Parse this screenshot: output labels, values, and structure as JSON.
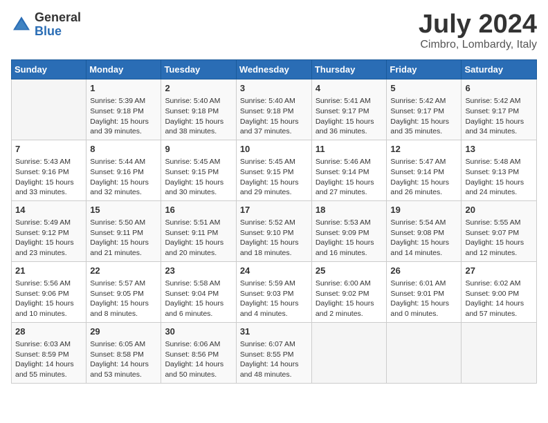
{
  "header": {
    "logo_general": "General",
    "logo_blue": "Blue",
    "month_year": "July 2024",
    "location": "Cimbro, Lombardy, Italy"
  },
  "columns": [
    "Sunday",
    "Monday",
    "Tuesday",
    "Wednesday",
    "Thursday",
    "Friday",
    "Saturday"
  ],
  "weeks": [
    [
      {
        "day": "",
        "info": ""
      },
      {
        "day": "1",
        "info": "Sunrise: 5:39 AM\nSunset: 9:18 PM\nDaylight: 15 hours\nand 39 minutes."
      },
      {
        "day": "2",
        "info": "Sunrise: 5:40 AM\nSunset: 9:18 PM\nDaylight: 15 hours\nand 38 minutes."
      },
      {
        "day": "3",
        "info": "Sunrise: 5:40 AM\nSunset: 9:18 PM\nDaylight: 15 hours\nand 37 minutes."
      },
      {
        "day": "4",
        "info": "Sunrise: 5:41 AM\nSunset: 9:17 PM\nDaylight: 15 hours\nand 36 minutes."
      },
      {
        "day": "5",
        "info": "Sunrise: 5:42 AM\nSunset: 9:17 PM\nDaylight: 15 hours\nand 35 minutes."
      },
      {
        "day": "6",
        "info": "Sunrise: 5:42 AM\nSunset: 9:17 PM\nDaylight: 15 hours\nand 34 minutes."
      }
    ],
    [
      {
        "day": "7",
        "info": "Sunrise: 5:43 AM\nSunset: 9:16 PM\nDaylight: 15 hours\nand 33 minutes."
      },
      {
        "day": "8",
        "info": "Sunrise: 5:44 AM\nSunset: 9:16 PM\nDaylight: 15 hours\nand 32 minutes."
      },
      {
        "day": "9",
        "info": "Sunrise: 5:45 AM\nSunset: 9:15 PM\nDaylight: 15 hours\nand 30 minutes."
      },
      {
        "day": "10",
        "info": "Sunrise: 5:45 AM\nSunset: 9:15 PM\nDaylight: 15 hours\nand 29 minutes."
      },
      {
        "day": "11",
        "info": "Sunrise: 5:46 AM\nSunset: 9:14 PM\nDaylight: 15 hours\nand 27 minutes."
      },
      {
        "day": "12",
        "info": "Sunrise: 5:47 AM\nSunset: 9:14 PM\nDaylight: 15 hours\nand 26 minutes."
      },
      {
        "day": "13",
        "info": "Sunrise: 5:48 AM\nSunset: 9:13 PM\nDaylight: 15 hours\nand 24 minutes."
      }
    ],
    [
      {
        "day": "14",
        "info": "Sunrise: 5:49 AM\nSunset: 9:12 PM\nDaylight: 15 hours\nand 23 minutes."
      },
      {
        "day": "15",
        "info": "Sunrise: 5:50 AM\nSunset: 9:11 PM\nDaylight: 15 hours\nand 21 minutes."
      },
      {
        "day": "16",
        "info": "Sunrise: 5:51 AM\nSunset: 9:11 PM\nDaylight: 15 hours\nand 20 minutes."
      },
      {
        "day": "17",
        "info": "Sunrise: 5:52 AM\nSunset: 9:10 PM\nDaylight: 15 hours\nand 18 minutes."
      },
      {
        "day": "18",
        "info": "Sunrise: 5:53 AM\nSunset: 9:09 PM\nDaylight: 15 hours\nand 16 minutes."
      },
      {
        "day": "19",
        "info": "Sunrise: 5:54 AM\nSunset: 9:08 PM\nDaylight: 15 hours\nand 14 minutes."
      },
      {
        "day": "20",
        "info": "Sunrise: 5:55 AM\nSunset: 9:07 PM\nDaylight: 15 hours\nand 12 minutes."
      }
    ],
    [
      {
        "day": "21",
        "info": "Sunrise: 5:56 AM\nSunset: 9:06 PM\nDaylight: 15 hours\nand 10 minutes."
      },
      {
        "day": "22",
        "info": "Sunrise: 5:57 AM\nSunset: 9:05 PM\nDaylight: 15 hours\nand 8 minutes."
      },
      {
        "day": "23",
        "info": "Sunrise: 5:58 AM\nSunset: 9:04 PM\nDaylight: 15 hours\nand 6 minutes."
      },
      {
        "day": "24",
        "info": "Sunrise: 5:59 AM\nSunset: 9:03 PM\nDaylight: 15 hours\nand 4 minutes."
      },
      {
        "day": "25",
        "info": "Sunrise: 6:00 AM\nSunset: 9:02 PM\nDaylight: 15 hours\nand 2 minutes."
      },
      {
        "day": "26",
        "info": "Sunrise: 6:01 AM\nSunset: 9:01 PM\nDaylight: 15 hours\nand 0 minutes."
      },
      {
        "day": "27",
        "info": "Sunrise: 6:02 AM\nSunset: 9:00 PM\nDaylight: 14 hours\nand 57 minutes."
      }
    ],
    [
      {
        "day": "28",
        "info": "Sunrise: 6:03 AM\nSunset: 8:59 PM\nDaylight: 14 hours\nand 55 minutes."
      },
      {
        "day": "29",
        "info": "Sunrise: 6:05 AM\nSunset: 8:58 PM\nDaylight: 14 hours\nand 53 minutes."
      },
      {
        "day": "30",
        "info": "Sunrise: 6:06 AM\nSunset: 8:56 PM\nDaylight: 14 hours\nand 50 minutes."
      },
      {
        "day": "31",
        "info": "Sunrise: 6:07 AM\nSunset: 8:55 PM\nDaylight: 14 hours\nand 48 minutes."
      },
      {
        "day": "",
        "info": ""
      },
      {
        "day": "",
        "info": ""
      },
      {
        "day": "",
        "info": ""
      }
    ]
  ]
}
